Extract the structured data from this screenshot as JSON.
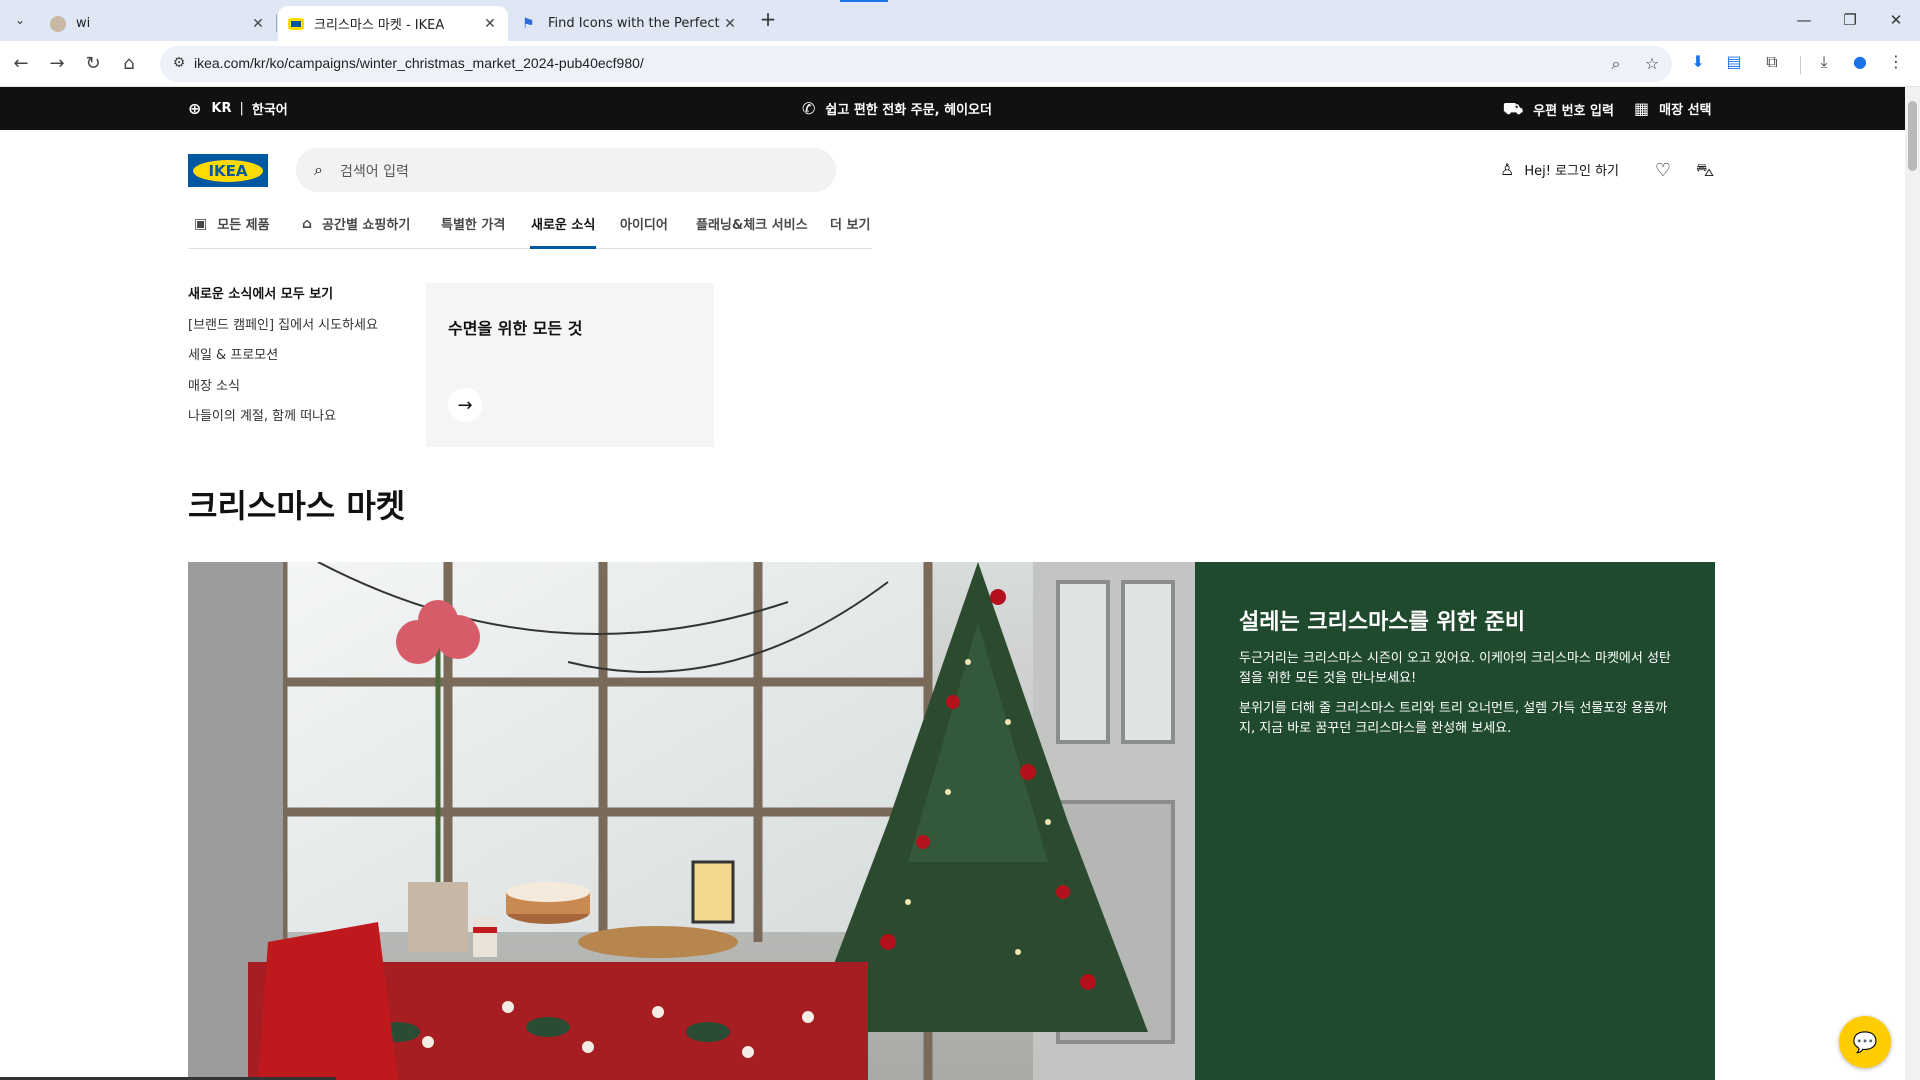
{
  "browser": {
    "tabs": [
      {
        "title": "wi",
        "active": false,
        "favicon": "avatar-favicon"
      },
      {
        "title": "크리스마스 마켓 - IKEA",
        "active": true,
        "favicon": "ikea-favicon"
      },
      {
        "title": "Find Icons with the Perfect Lo",
        "active": false,
        "favicon": "flag-favicon"
      }
    ],
    "url": "ikea.com/kr/ko/campaigns/winter_christmas_market_2024-pub40ecf980/",
    "icons": {
      "tab_menu": "chevron-down-icon",
      "new_tab": "plus-icon",
      "back": "arrow-left-icon",
      "forward": "arrow-right-icon",
      "reload": "reload-icon",
      "home": "home-icon",
      "site_info": "tune-icon",
      "zoom": "zoom-icon",
      "bookmark": "star-icon",
      "extensions": "puzzle-icon",
      "downloads": "download-icon",
      "profile": "profile-icon",
      "menu": "kebab-icon"
    }
  },
  "ikea": {
    "topbar": {
      "country": "KR",
      "language": "한국어",
      "phone_order": "쉽고 편한 전화 주문, 헤이오더",
      "postcode": "우편 번호 입력",
      "store": "매장 선택"
    },
    "logo_text": "IKEA",
    "search_placeholder": "검색어 입력",
    "login": "Hej! 로그인 하기",
    "nav": [
      "모든 제품",
      "공간별 쇼핑하기",
      "특별한 가격",
      "새로운 소식",
      "아이디어",
      "플래닝&체크 서비스",
      "더 보기"
    ],
    "submenu": [
      "새로운 소식에서 모두 보기",
      "[브랜드 캠페인] 집에서 시도하세요",
      "세일 & 프로모션",
      "매장 소식",
      "나들이의 계절, 함께 떠나요"
    ],
    "promo_card_title": "수면을 위한 모든 것",
    "page_title": "크리스마스 마켓",
    "hero": {
      "heading": "설레는 크리스마스를 위한 준비",
      "para1": "두근거리는 크리스마스 시즌이 오고 있어요. 이케아의 크리스마스 마켓에서 성탄절을 위한 모든 것을 만나보세요!",
      "para2": "분위기를 더해 줄 크리스마스 트리와 트리 오너먼트, 설렘 가득 선물포장 용품까지, 지금 바로 꿈꾸던 크리스마스를 완성해 보세요."
    },
    "colors": {
      "brand_blue": "#0058a3",
      "brand_yellow": "#ffdb00",
      "hero_green": "#1f4a2d",
      "chat_yellow": "#ffcc00"
    }
  }
}
